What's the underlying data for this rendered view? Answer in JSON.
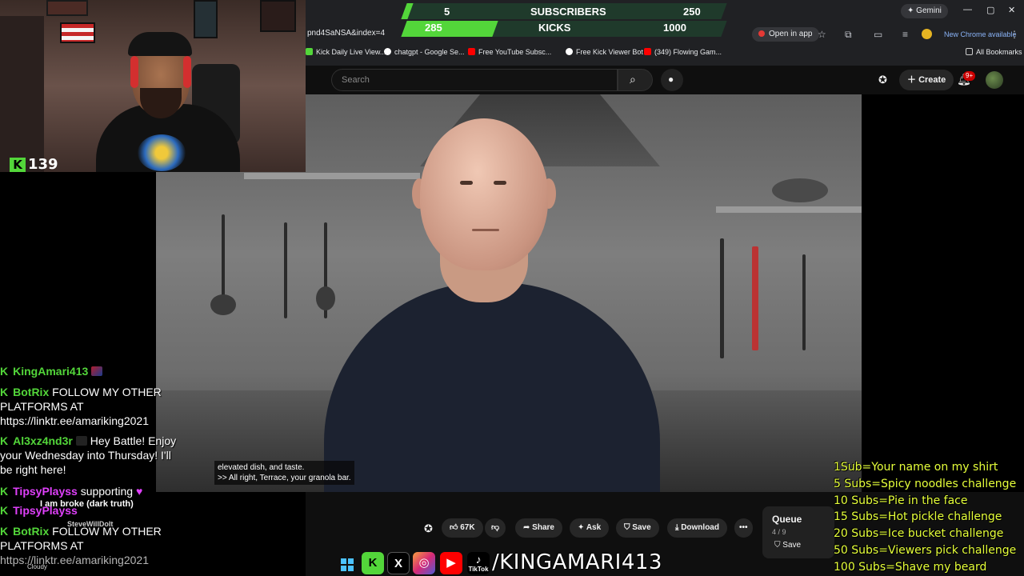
{
  "browser": {
    "url_fragment": "pnd4SaNSA&index=4",
    "open_in_app": "Open in app",
    "gemini": "Gemini",
    "new_chrome": "New Chrome available",
    "all_bookmarks": "All Bookmarks",
    "bookmarks": [
      {
        "label": "Kick Daily Live View...",
        "color": "#53d63a"
      },
      {
        "label": "chatgpt - Google Se...",
        "color": "#ffffff"
      },
      {
        "label": "Free YouTube Subsc...",
        "color": "#ff0000"
      },
      {
        "label": "Free Kick Viewer Bot",
        "color": "#ffffff"
      },
      {
        "label": "(349) Flowing Gam...",
        "color": "#ff0000"
      }
    ]
  },
  "counter": {
    "subs_current": "5",
    "subs_label": "SUBSCRIBERS",
    "subs_goal": "250",
    "kicks_current": "285",
    "kicks_label": "KICKS",
    "kicks_goal": "1000",
    "subs_progress": 0.02,
    "kicks_progress": 0.285
  },
  "youtube": {
    "search_placeholder": "Search",
    "create_label": "Create",
    "notif_count": "9+",
    "captions": [
      ">> All right, Terrace, your granola bar."
    ],
    "caption_line1": "elevated dish, and taste.",
    "actions": {
      "like_count": "67K",
      "share": "Share",
      "ask": "Ask",
      "save": "Save",
      "download": "Download"
    },
    "queue": {
      "title": "Queue",
      "count": "4 / 9",
      "save": "Save"
    }
  },
  "webcam": {
    "viewer_count": "139"
  },
  "chat": [
    {
      "user": "KingAmari413",
      "color": "#53d63a",
      "message": "",
      "badge": true
    },
    {
      "user": "BotRix",
      "color": "#53d63a",
      "message": "FOLLOW MY OTHER"
    },
    {
      "user": "",
      "color": "#ffffff",
      "message": "PLATFORMS AT"
    },
    {
      "user": "",
      "color": "#ffffff",
      "message": "https://linktr.ee/amariking2021"
    },
    {
      "user": "Al3xz4nd3r",
      "color": "#53d63a",
      "message": "Hey Battle! Enjoy"
    },
    {
      "user": "",
      "color": "#ffffff",
      "message": "your Wednesday into Thursday! I'll"
    },
    {
      "user": "",
      "color": "#ffffff",
      "message": "be right here!"
    },
    {
      "user": "TipsyPlayss",
      "color": "#e040fb",
      "message": "supporting"
    },
    {
      "user": "TipsyPlayss",
      "color": "#e040fb",
      "message": ""
    },
    {
      "user": "BotRix",
      "color": "#53d63a",
      "message": "FOLLOW MY OTHER"
    },
    {
      "user": "",
      "color": "#ffffff",
      "message": "PLATFORMS AT"
    },
    {
      "user": "",
      "color": "#ffffff",
      "message": "https://linktr.ee/amariking2021"
    }
  ],
  "overlay_text": {
    "clip_title": "I am broke (dark truth)",
    "clip_user": "SteveWillDoIt",
    "weather": "Cloudy"
  },
  "goals": [
    "1Sub=Your name on my shirt",
    "5 Subs=Spicy noodles challenge",
    "10 Subs=Pie in the face",
    "15 Subs=Hot pickle challenge",
    "20 Subs=Ice bucket challenge",
    "50 Subs=Viewers pick challenge",
    "100 Subs=Shave my beard"
  ],
  "social": {
    "handle": "/KINGAMARI413",
    "tiktok_label": "TikTok"
  },
  "colors": {
    "kick_green": "#53d63a",
    "goal_yellow": "#e6ff3a",
    "youtube_bg": "#0f0f0f"
  }
}
